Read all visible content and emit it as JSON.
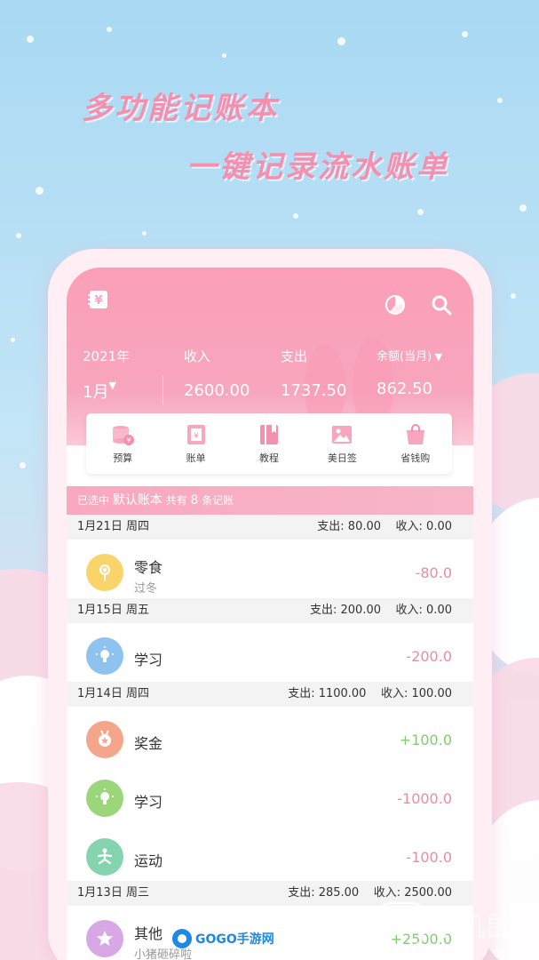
{
  "headline": {
    "line1": "多功能记账本",
    "line2": "一键记录流水账单"
  },
  "header": {
    "year": "2021年",
    "month": "1月",
    "income_label": "收入",
    "income_value": "2600.00",
    "expense_label": "支出",
    "expense_value": "1737.50",
    "balance_label": "余额(当月)",
    "balance_value": "862.50"
  },
  "menu": [
    {
      "label": "预算",
      "icon": "coins-icon"
    },
    {
      "label": "账单",
      "icon": "receipt-icon"
    },
    {
      "label": "教程",
      "icon": "book-icon"
    },
    {
      "label": "美日签",
      "icon": "image-icon"
    },
    {
      "label": "省钱购",
      "icon": "shopping-bag-icon"
    }
  ],
  "banner": {
    "prefix": "已选中",
    "book": "默认账本",
    "count_prefix": "共有",
    "count": "8",
    "count_suffix": "条记账"
  },
  "days": [
    {
      "date": "1月21日 周四",
      "summary": "支出: 80.00    收入: 0.00"
    },
    {
      "date": "1月15日 周五",
      "summary": "支出: 200.00    收入: 0.00"
    },
    {
      "date": "1月14日 周四",
      "summary": "支出: 1100.00    收入: 100.00"
    },
    {
      "date": "1月13日 周三",
      "summary": "支出: 285.00    收入: 2500.00"
    }
  ],
  "entries": [
    {
      "category": "零食",
      "note": "过冬",
      "amount": "-80.0",
      "icon": "lollipop-icon",
      "color": "#f8d46b"
    },
    {
      "category": "学习",
      "note": "",
      "amount": "-200.0",
      "icon": "lightbulb-icon",
      "color": "#8ec3ef"
    },
    {
      "category": "奖金",
      "note": "",
      "amount": "+100.0",
      "icon": "medal-icon",
      "color": "#f5a58a"
    },
    {
      "category": "学习",
      "note": "",
      "amount": "-1000.0",
      "icon": "lightbulb-icon",
      "color": "#9bd77a"
    },
    {
      "category": "运动",
      "note": "",
      "amount": "-100.0",
      "icon": "yoga-icon",
      "color": "#86d3b0"
    },
    {
      "category": "其他",
      "note": "小猪砸碎啦",
      "amount": "+2500.0",
      "icon": "star-icon",
      "color": "#d7a7e6"
    }
  ],
  "watermarks": {
    "gogo": "GOGO手游网",
    "right": "手机鼠"
  },
  "colors": {
    "accent": "#f7a6bd",
    "negative": "#ee8aa4",
    "positive": "#7ccf6b"
  }
}
